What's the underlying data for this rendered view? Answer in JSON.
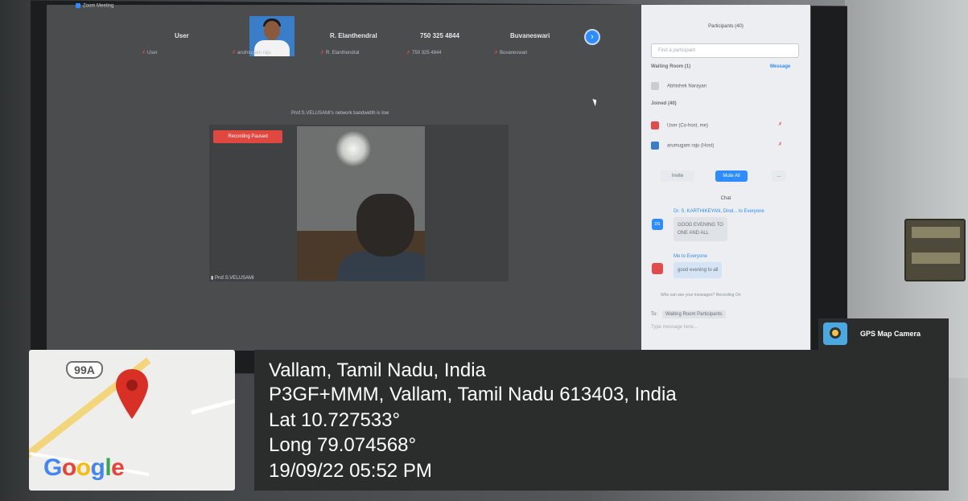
{
  "zoom": {
    "window_title": "Zoom Meeting",
    "strip": [
      {
        "name": "User",
        "sub": "User"
      },
      {
        "name": "",
        "sub": "arulmugam raju"
      },
      {
        "name": "R. Elanthendral",
        "sub": "R. Elanthendral"
      },
      {
        "name": "750 325 4844",
        "sub": "750 325 4844"
      },
      {
        "name": "Buvaneswari",
        "sub": "Buvaneswari"
      }
    ],
    "next_icon": "chevron-right-icon",
    "bandwidth_notice": "Prof.S.VELUSAMI's network bandwidth is low",
    "recording_badge": "Recording Paused",
    "active_speaker": "Prof.S.VELUSAMI"
  },
  "panel": {
    "title": "Participants (40)",
    "search_placeholder": "Find a participant",
    "waiting_room_label": "Waiting Room (1)",
    "message_link": "Message",
    "waiting_person": "Abhishek Narayan",
    "joined_label": "Joined (40)",
    "joined": [
      {
        "name": "User (Co-host, me)",
        "color": "#e24b4b"
      },
      {
        "name": "arumugam raju (Host)",
        "color": "#3a7ec9"
      }
    ],
    "invite_label": "Invite",
    "mute_all_label": "Mute All",
    "more_label": "...",
    "chat_title": "Chat",
    "messages": [
      {
        "from": "Dr. S. KARTHIKEYAN, Dind... to Everyone",
        "text_line1": "GOOD EVENING TO",
        "text_line2": "ONE AND ALL",
        "avatar_text": "DS",
        "color": "#2d8cff"
      },
      {
        "from": "Me to Everyone",
        "text_line1": "good evening to all",
        "text_line2": "",
        "avatar_text": "",
        "color": "#e24b4b"
      }
    ],
    "who_can_see": "Who can see your messages? Recording On",
    "to_label": "To:",
    "to_value": "Waiting Room Participants",
    "input_placeholder": "Type message here..."
  },
  "overlay": {
    "map_badge": "99A",
    "logo": {
      "G": "G",
      "o1": "o",
      "o2": "o",
      "g": "g",
      "l": "l",
      "e": "e"
    },
    "logo_colors": {
      "blue": "#4285f4",
      "red": "#ea4335",
      "yellow": "#fbbc05",
      "green": "#34a853"
    },
    "pin_color": "#d93025",
    "gps_label": "GPS Map Camera",
    "lines": [
      "Vallam, Tamil Nadu, India",
      "P3GF+MMM, Vallam, Tamil Nadu 613403, India",
      "Lat 10.727533°",
      "Long 79.074568°",
      "19/09/22 05:52 PM"
    ]
  }
}
